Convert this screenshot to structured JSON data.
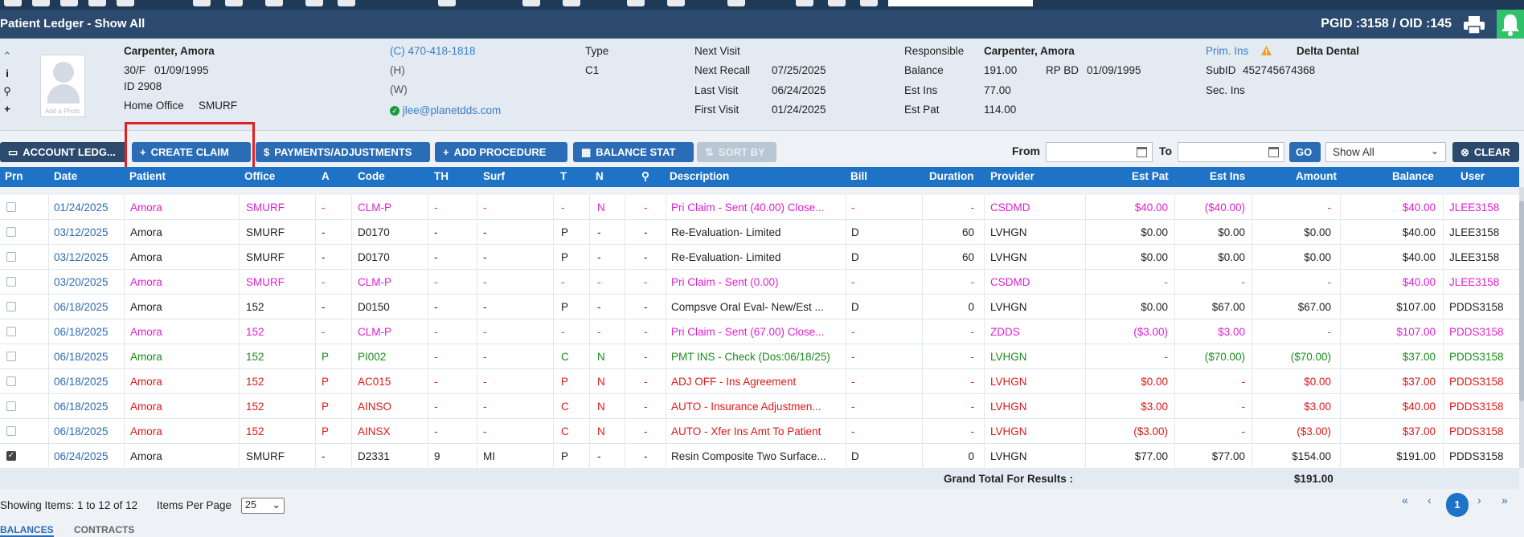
{
  "titlebar": {
    "title": "Patient Ledger - Show All",
    "pgid": "PGID :3158  /  OID :145"
  },
  "patient": {
    "name": "Carpenter, Amora",
    "agegender": "30/F",
    "dob": "01/09/1995",
    "id": "ID 2908",
    "home_office_label": "Home Office",
    "home_office": "SMURF",
    "photo_caption": "Add a Photo",
    "phone_cell": "(C)  470-418-1818",
    "phone_home": "(H)",
    "phone_work": "(W)",
    "email": "jlee@planetdds.com",
    "type_label": "Type",
    "type": "C1",
    "next_visit_label": "Next Visit",
    "next_recall_label": "Next Recall",
    "next_recall": "07/25/2025",
    "last_visit_label": "Last Visit",
    "last_visit": "06/24/2025",
    "first_visit_label": "First Visit",
    "first_visit": "01/24/2025",
    "responsible_label": "Responsible",
    "responsible": "Carpenter, Amora",
    "balance_label": "Balance",
    "balance": "191.00",
    "rpbd_label": "RP BD",
    "rpbd": "01/09/1995",
    "est_ins_label": "Est Ins",
    "est_ins": "77.00",
    "est_pat_label": "Est Pat",
    "est_pat": "114.00",
    "prim_ins_label": "Prim. Ins",
    "prim_ins": "Delta Dental",
    "subid_label": "SubID",
    "subid": "452745674368",
    "sec_ins_label": "Sec. Ins"
  },
  "toolbar": {
    "account_ledger": "ACCOUNT LEDG...",
    "create_claim": "CREATE CLAIM",
    "payments": "PAYMENTS/ADJUSTMENTS",
    "add_procedure": "ADD PROCEDURE",
    "balance_stat": "BALANCE STAT",
    "sort_by": "SORT BY",
    "from_label": "From",
    "to_label": "To",
    "go": "GO",
    "filter": "Show All",
    "clear": "CLEAR"
  },
  "columns": [
    "Prn",
    "Date",
    "Patient",
    "Office",
    "A",
    "Code",
    "TH",
    "Surf",
    "T",
    "N",
    "",
    "Description",
    "Bill",
    "Duration",
    "Provider",
    "Est Pat",
    "Est Ins",
    "Amount",
    "Balance",
    "User"
  ],
  "colors": {
    "magenta": "#e020d0",
    "green": "#1a8a1a",
    "red": "#e01818",
    "black": "#222222",
    "date": "#2b6cb7"
  },
  "rows": [
    {
      "prn": false,
      "date": "01/24/2025",
      "patient": "Amora",
      "office": "SMURF",
      "a": "-",
      "code": "CLM-P",
      "th": "-",
      "surf": "-",
      "t": "-",
      "n": "N",
      "att": "-",
      "desc": "Pri Claim - Sent (40.00) Close...",
      "bill": "-",
      "dur": "-",
      "prov": "CSDMD",
      "estpat": "$40.00",
      "estins": "($40.00)",
      "amount": "-",
      "balance": "$40.00",
      "user": "JLEE3158",
      "color": "magenta"
    },
    {
      "prn": false,
      "date": "03/12/2025",
      "patient": "Amora",
      "office": "SMURF",
      "a": "-",
      "code": "D0170",
      "th": "-",
      "surf": "-",
      "t": "P",
      "n": "-",
      "att": "-",
      "desc": "Re-Evaluation- Limited",
      "bill": "D",
      "dur": "60",
      "prov": "LVHGN",
      "estpat": "$0.00",
      "estins": "$0.00",
      "amount": "$0.00",
      "balance": "$40.00",
      "user": "JLEE3158",
      "color": "black"
    },
    {
      "prn": false,
      "date": "03/12/2025",
      "patient": "Amora",
      "office": "SMURF",
      "a": "-",
      "code": "D0170",
      "th": "-",
      "surf": "-",
      "t": "P",
      "n": "-",
      "att": "-",
      "desc": "Re-Evaluation- Limited",
      "bill": "D",
      "dur": "60",
      "prov": "LVHGN",
      "estpat": "$0.00",
      "estins": "$0.00",
      "amount": "$0.00",
      "balance": "$40.00",
      "user": "JLEE3158",
      "color": "black"
    },
    {
      "prn": false,
      "date": "03/20/2025",
      "patient": "Amora",
      "office": "SMURF",
      "a": "-",
      "code": "CLM-P",
      "th": "-",
      "surf": "-",
      "t": "-",
      "n": "-",
      "att": "-",
      "desc": "Pri Claim - Sent (0.00)",
      "bill": "-",
      "dur": "-",
      "prov": "CSDMD",
      "estpat": "-",
      "estins": "-",
      "amount": "-",
      "balance": "$40.00",
      "user": "JLEE3158",
      "color": "magenta"
    },
    {
      "prn": false,
      "date": "06/18/2025",
      "patient": "Amora",
      "office": "152",
      "a": "-",
      "code": "D0150",
      "th": "-",
      "surf": "-",
      "t": "P",
      "n": "-",
      "att": "-",
      "desc": "Compsve Oral Eval- New/Est ...",
      "bill": "D",
      "dur": "0",
      "prov": "LVHGN",
      "estpat": "$0.00",
      "estins": "$67.00",
      "amount": "$67.00",
      "balance": "$107.00",
      "user": "PDDS3158",
      "color": "black"
    },
    {
      "prn": false,
      "date": "06/18/2025",
      "patient": "Amora",
      "office": "152",
      "a": "-",
      "code": "CLM-P",
      "th": "-",
      "surf": "-",
      "t": "-",
      "n": "-",
      "att": "-",
      "desc": "Pri Claim - Sent (67.00) Close...",
      "bill": "-",
      "dur": "-",
      "prov": "ZDDS",
      "estpat": "($3.00)",
      "estins": "$3.00",
      "amount": "-",
      "balance": "$107.00",
      "user": "PDDS3158",
      "color": "magenta"
    },
    {
      "prn": false,
      "date": "06/18/2025",
      "patient": "Amora",
      "office": "152",
      "a": "P",
      "code": "PI002",
      "th": "-",
      "surf": "-",
      "t": "C",
      "n": "N",
      "att": "-",
      "desc": "PMT INS - Check (Dos:06/18/25)",
      "bill": "-",
      "dur": "-",
      "prov": "LVHGN",
      "estpat": "-",
      "estins": "($70.00)",
      "amount": "($70.00)",
      "balance": "$37.00",
      "user": "PDDS3158",
      "color": "green"
    },
    {
      "prn": false,
      "date": "06/18/2025",
      "patient": "Amora",
      "office": "152",
      "a": "P",
      "code": "AC015",
      "th": "-",
      "surf": "-",
      "t": "P",
      "n": "N",
      "att": "-",
      "desc": "ADJ OFF - Ins Agreement",
      "bill": "-",
      "dur": "-",
      "prov": "LVHGN",
      "estpat": "$0.00",
      "estins": "-",
      "amount": "$0.00",
      "balance": "$37.00",
      "user": "PDDS3158",
      "color": "red"
    },
    {
      "prn": false,
      "date": "06/18/2025",
      "patient": "Amora",
      "office": "152",
      "a": "P",
      "code": "AINSO",
      "th": "-",
      "surf": "-",
      "t": "C",
      "n": "N",
      "att": "-",
      "desc": "AUTO - Insurance Adjustmen...",
      "bill": "-",
      "dur": "-",
      "prov": "LVHGN",
      "estpat": "$3.00",
      "estins": "-",
      "amount": "$3.00",
      "balance": "$40.00",
      "user": "PDDS3158",
      "color": "red"
    },
    {
      "prn": false,
      "date": "06/18/2025",
      "patient": "Amora",
      "office": "152",
      "a": "P",
      "code": "AINSX",
      "th": "-",
      "surf": "-",
      "t": "C",
      "n": "N",
      "att": "-",
      "desc": "AUTO - Xfer Ins Amt To Patient",
      "bill": "-",
      "dur": "-",
      "prov": "LVHGN",
      "estpat": "($3.00)",
      "estins": "-",
      "amount": "($3.00)",
      "balance": "$37.00",
      "user": "PDDS3158",
      "color": "red"
    },
    {
      "prn": true,
      "date": "06/24/2025",
      "patient": "Amora",
      "office": "SMURF",
      "a": "-",
      "code": "D2331",
      "th": "9",
      "surf": "MI",
      "t": "P",
      "n": "-",
      "att": "-",
      "desc": "Resin Composite Two Surface...",
      "bill": "D",
      "dur": "0",
      "prov": "LVHGN",
      "estpat": "$77.00",
      "estins": "$77.00",
      "amount": "$154.00",
      "balance": "$191.00",
      "user": "PDDS3158",
      "color": "black"
    }
  ],
  "grand_total": {
    "label": "Grand Total For Results :",
    "value": "$191.00"
  },
  "footer": {
    "showing": "Showing Items: 1 to 12 of 12",
    "per_page_label": "Items Per Page",
    "per_page": "25",
    "page_first": "«",
    "page_prev": "‹",
    "page_current": "1",
    "page_next": "›",
    "page_last": "»",
    "tab_balances": "BALANCES",
    "tab_contracts": "CONTRACTS"
  }
}
